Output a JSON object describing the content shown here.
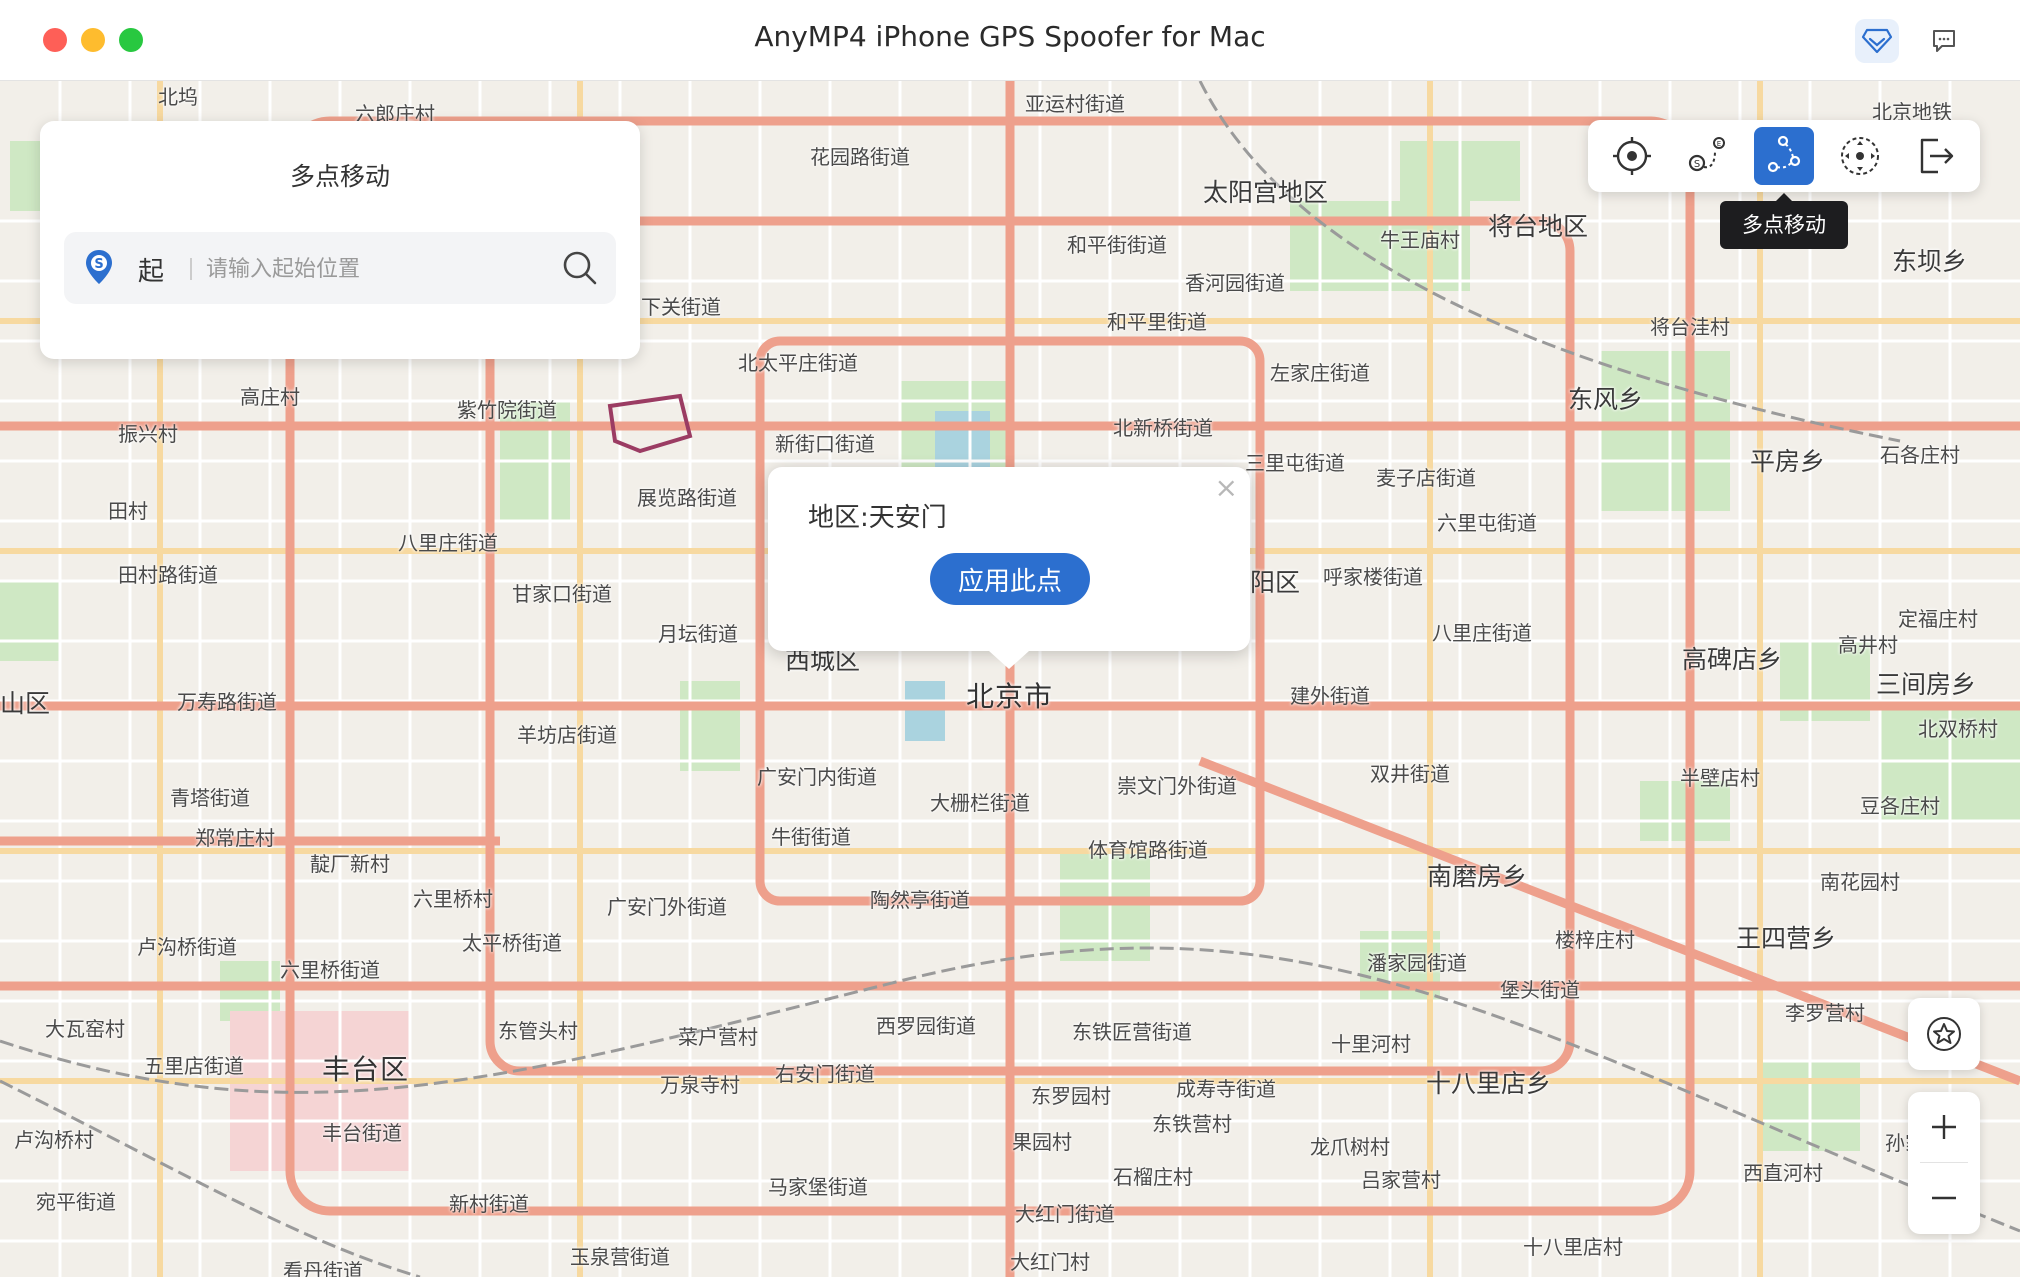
{
  "window": {
    "title": "AnyMP4 iPhone GPS Spoofer for Mac",
    "controls": [
      "close",
      "minimize",
      "maximize"
    ],
    "title_icons": [
      "premium-diamond-icon",
      "feedback-chat-icon"
    ]
  },
  "panel": {
    "title": "多点移动",
    "start_label": "起",
    "search_placeholder": "请输入起始位置"
  },
  "toolbar": {
    "tools": [
      "location-target-icon",
      "route-two-point-icon",
      "multi-point-route-icon",
      "joystick-icon",
      "exit-icon"
    ],
    "active_tool": "multi-point-route-icon",
    "tooltip": "多点移动"
  },
  "popup": {
    "text": "地区:天安门",
    "apply_label": "应用此点"
  },
  "map_controls": {
    "zoom_in": "+",
    "zoom_out": "−"
  },
  "map_labels": [
    "北坞",
    "六郎庄村",
    "亚运村街道",
    "北京地铁",
    "花园路街道",
    "太阳宫地区",
    "将台地区",
    "牛王庙村",
    "和平街街道",
    "香河园街道",
    "和平里街道",
    "东坝乡",
    "下关街道",
    "北太平庄街道",
    "左家庄街道",
    "将台洼村",
    "东风乡",
    "高庄村",
    "紫竹院街道",
    "振兴村",
    "新街口街道",
    "北新桥街道",
    "三里屯街道",
    "麦子店街道",
    "平房乡",
    "石各庄村",
    "田村",
    "展览路街道",
    "六里屯街道",
    "八里庄街道",
    "田村路街道",
    "甘家口街道",
    "阳区",
    "呼家楼街道",
    "月坛街道",
    "八里庄街道",
    "定福庄村",
    "高井村",
    "西城区",
    "北京市",
    "高碑店乡",
    "三间房乡",
    "山区",
    "万寿路街道",
    "建外街道",
    "北双桥村",
    "羊坊店街道",
    "双井街道",
    "半壁店村",
    "青塔街道",
    "广安门内街道",
    "崇文门外街道",
    "大栅栏街道",
    "豆各庄村",
    "郑常庄村",
    "靛厂新村",
    "牛街街道",
    "体育馆路街道",
    "南磨房乡",
    "六里桥村",
    "南花园村",
    "广安门外街道",
    "陶然亭街道",
    "卢沟桥街道",
    "太平桥街道",
    "楼梓庄村",
    "王四营乡",
    "六里桥街道",
    "潘家园街道",
    "堡头街道",
    "大瓦窑村",
    "东管头村",
    "菜户营村",
    "西罗园街道",
    "东铁匠营街道",
    "十里河村",
    "李罗营村",
    "五里店街道",
    "丰台区",
    "万泉寺村",
    "右安门街道",
    "东罗园村",
    "成寿寺街道",
    "十八里店乡",
    "卢沟桥村",
    "丰台街道",
    "果园村",
    "东铁营村",
    "龙爪树村",
    "孙家",
    "石榴庄村",
    "吕家营村",
    "西直河村",
    "宛平街道",
    "马家堡街道",
    "新村街道",
    "大红门街道",
    "玉泉营街道",
    "大红门村",
    "十八里店村",
    "看丹街道"
  ]
}
